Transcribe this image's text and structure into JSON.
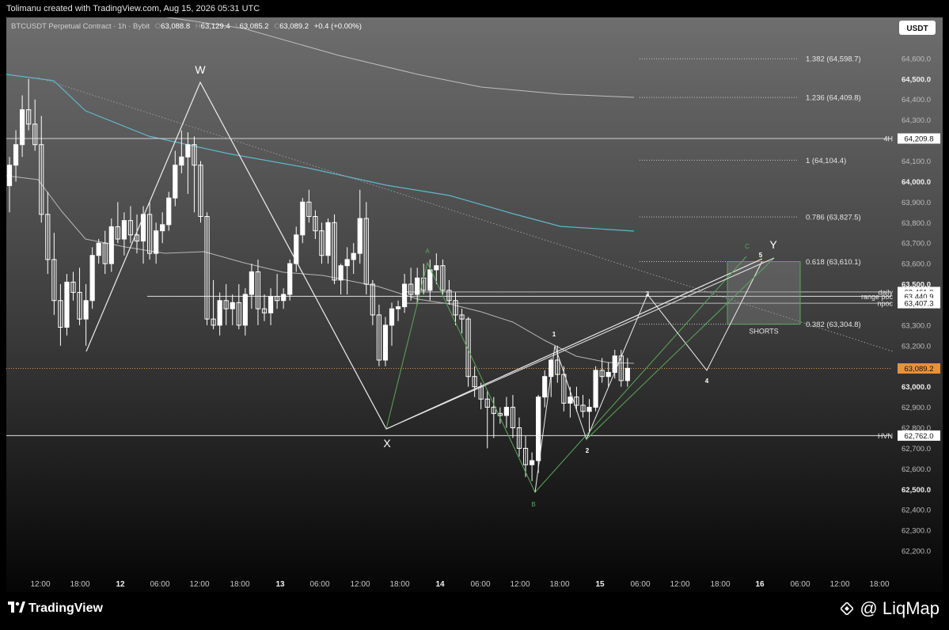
{
  "header": {
    "credit": "Tolimanu created with TradingView.com, Aug 15, 2026 05:31 UTC"
  },
  "legend": {
    "symbol": "BTCUSDT Perpetual Contract · 1h · Bybit",
    "o_label": "O",
    "o": "63,088.8",
    "h_label": "H",
    "h": "63,129.4",
    "l_label": "L",
    "l": "63,085.2",
    "c_label": "C",
    "c": "63,089.2",
    "change": "+0.4 (+0.00%)"
  },
  "currency_button": "USDT",
  "branding": {
    "tradingview": "TradingView",
    "liqmap": "@ LiqMap"
  },
  "colors": {
    "background_top": "#6e6e6e",
    "background_bottom": "#000000",
    "candle": "#ffffff",
    "ema_slow": "#bdbdbd",
    "ema_mid": "#5fb7c8",
    "green_wave": "#5aa85a",
    "price_badge": "#e8923a"
  },
  "chart_data": {
    "type": "candlestick",
    "symbol": "BTCUSDT",
    "timeframe": "1h",
    "ylim": [
      62100,
      64800
    ],
    "x_tick_labels": [
      "12:00",
      "18:00",
      "12",
      "06:00",
      "12:00",
      "18:00",
      "13",
      "06:00",
      "12:00",
      "18:00",
      "14",
      "06:00",
      "12:00",
      "18:00",
      "15",
      "06:00",
      "12:00",
      "18:00",
      "16",
      "06:00",
      "12:00",
      "18:00"
    ],
    "x_tick_bold": [
      false,
      false,
      true,
      false,
      false,
      false,
      true,
      false,
      false,
      false,
      true,
      false,
      false,
      false,
      true,
      false,
      false,
      false,
      true,
      false,
      false,
      false
    ],
    "y_ticks": [
      "62,200.0",
      "62,300.0",
      "62,400.0",
      "62,500.0",
      "62,600.0",
      "62,700.0",
      "62,800.0",
      "62,900.0",
      "63,000.0",
      "63,100.0",
      "63,200.0",
      "63,300.0",
      "63,400.0",
      "63,500.0",
      "63,600.0",
      "63,700.0",
      "63,800.0",
      "63,900.0",
      "64,000.0",
      "64,100.0",
      "64,200.0",
      "64,300.0",
      "64,400.0",
      "64,500.0",
      "64,600.0"
    ],
    "last_price": "63,089.2",
    "price_badges": [
      {
        "label": "4H",
        "value": "64,209.8"
      },
      {
        "label": "daily",
        "value": "63,461.9"
      },
      {
        "label": "range poc",
        "value": "63,440.9"
      },
      {
        "label": "npoc",
        "value": "63,407.3"
      },
      {
        "label": "HVN",
        "value": "62,762.0"
      }
    ],
    "fib_levels": [
      {
        "label": "1.382 (64,598.7)",
        "price": 64598.7
      },
      {
        "label": "1.236 (64,409.8)",
        "price": 64409.8
      },
      {
        "label": "1 (64,104.4)",
        "price": 64104.4
      },
      {
        "label": "0.786 (63,827.5)",
        "price": 63827.5
      },
      {
        "label": "0.618 (63,610.1)",
        "price": 63610.1
      },
      {
        "label": "0.382 (63,304.8)",
        "price": 63304.8
      }
    ],
    "zone_label": "SHORTS",
    "wave_labels_white": [
      "W",
      "X",
      "Y"
    ],
    "wave_labels_green": [
      "A",
      "B",
      "C"
    ],
    "impulse_labels": [
      "1",
      "2",
      "3",
      "4",
      "5"
    ],
    "candles": [
      [
        63980,
        64120,
        63850,
        64080
      ],
      [
        64080,
        64250,
        64000,
        64180
      ],
      [
        64180,
        64420,
        64120,
        64350
      ],
      [
        64350,
        64500,
        64250,
        64280
      ],
      [
        64280,
        64400,
        64150,
        64180
      ],
      [
        64180,
        64320,
        63800,
        63840
      ],
      [
        63840,
        63950,
        63550,
        63620
      ],
      [
        63620,
        63750,
        63350,
        63420
      ],
      [
        63420,
        63500,
        63200,
        63290
      ],
      [
        63290,
        63550,
        63250,
        63510
      ],
      [
        63510,
        63560,
        63420,
        63460
      ],
      [
        63460,
        63580,
        63300,
        63330
      ],
      [
        63330,
        63500,
        63200,
        63420
      ],
      [
        63420,
        63680,
        63380,
        63640
      ],
      [
        63640,
        63720,
        63600,
        63700
      ],
      [
        63700,
        63760,
        63550,
        63600
      ],
      [
        63600,
        63820,
        63560,
        63780
      ],
      [
        63780,
        63900,
        63700,
        63720
      ],
      [
        63720,
        63850,
        63640,
        63810
      ],
      [
        63810,
        63880,
        63700,
        63740
      ],
      [
        63740,
        63840,
        63650,
        63710
      ],
      [
        63710,
        63880,
        63600,
        63840
      ],
      [
        63840,
        63900,
        63620,
        63650
      ],
      [
        63650,
        63800,
        63600,
        63760
      ],
      [
        63760,
        63850,
        63700,
        63790
      ],
      [
        63790,
        63950,
        63760,
        63920
      ],
      [
        63920,
        64150,
        63880,
        64080
      ],
      [
        64080,
        64250,
        64040,
        64120
      ],
      [
        64120,
        64240,
        63940,
        64180
      ],
      [
        64180,
        64220,
        63850,
        64080
      ],
      [
        64080,
        64100,
        63800,
        63830
      ],
      [
        63830,
        63850,
        63300,
        63330
      ],
      [
        63330,
        63520,
        63280,
        63300
      ],
      [
        63300,
        63460,
        63250,
        63420
      ],
      [
        63420,
        63500,
        63300,
        63380
      ],
      [
        63380,
        63450,
        63300,
        63410
      ],
      [
        63410,
        63500,
        63280,
        63300
      ],
      [
        63300,
        63480,
        63250,
        63450
      ],
      [
        63450,
        63600,
        63380,
        63560
      ],
      [
        63560,
        63620,
        63300,
        63380
      ],
      [
        63380,
        63450,
        63320,
        63360
      ],
      [
        63360,
        63480,
        63300,
        63440
      ],
      [
        63440,
        63550,
        63380,
        63420
      ],
      [
        63420,
        63480,
        63380,
        63450
      ],
      [
        63450,
        63620,
        63420,
        63600
      ],
      [
        63600,
        63780,
        63560,
        63740
      ],
      [
        63740,
        63920,
        63700,
        63900
      ],
      [
        63900,
        63960,
        63800,
        63830
      ],
      [
        63830,
        63860,
        63720,
        63760
      ],
      [
        63760,
        63800,
        63600,
        63640
      ],
      [
        63640,
        63820,
        63600,
        63800
      ],
      [
        63800,
        63840,
        63500,
        63520
      ],
      [
        63520,
        63600,
        63450,
        63590
      ],
      [
        63590,
        63680,
        63450,
        63620
      ],
      [
        63620,
        63700,
        63550,
        63650
      ],
      [
        63650,
        63960,
        63600,
        63820
      ],
      [
        63820,
        63900,
        63450,
        63500
      ],
      [
        63500,
        63520,
        63300,
        63350
      ],
      [
        63350,
        63400,
        63100,
        63130
      ],
      [
        63130,
        63340,
        63100,
        63300
      ],
      [
        63300,
        63410,
        63200,
        63380
      ],
      [
        63380,
        63420,
        63320,
        63390
      ],
      [
        63390,
        63550,
        63360,
        63500
      ],
      [
        63500,
        63580,
        63420,
        63450
      ],
      [
        63450,
        63580,
        63400,
        63530
      ],
      [
        63530,
        63600,
        63450,
        63470
      ],
      [
        63470,
        63620,
        63420,
        63570
      ],
      [
        63570,
        63650,
        63500,
        63590
      ],
      [
        63590,
        63620,
        63450,
        63470
      ],
      [
        63470,
        63520,
        63400,
        63420
      ],
      [
        63420,
        63460,
        63300,
        63350
      ],
      [
        63350,
        63380,
        63260,
        63330
      ],
      [
        63330,
        63340,
        63000,
        63050
      ],
      [
        63050,
        63100,
        62950,
        63000
      ],
      [
        63000,
        63020,
        62890,
        62940
      ],
      [
        62940,
        62980,
        62700,
        62900
      ],
      [
        62900,
        62950,
        62750,
        62870
      ],
      [
        62870,
        62900,
        62820,
        62860
      ],
      [
        62860,
        62950,
        62800,
        62900
      ],
      [
        62900,
        62960,
        62750,
        62800
      ],
      [
        62800,
        62850,
        62660,
        62700
      ],
      [
        62700,
        62760,
        62560,
        62620
      ],
      [
        62620,
        62680,
        62540,
        62640
      ],
      [
        62640,
        62960,
        62580,
        62950
      ],
      [
        62950,
        63080,
        62900,
        63050
      ],
      [
        63050,
        63140,
        62950,
        63130
      ],
      [
        63130,
        63200,
        63020,
        63060
      ],
      [
        63060,
        63100,
        62880,
        62920
      ],
      [
        62920,
        63000,
        62850,
        62950
      ],
      [
        62950,
        63000,
        62880,
        62910
      ],
      [
        62910,
        62960,
        62850,
        62880
      ],
      [
        62880,
        62940,
        62780,
        62900
      ],
      [
        62900,
        63100,
        62880,
        63080
      ],
      [
        63080,
        63140,
        63020,
        63050
      ],
      [
        63050,
        63120,
        63000,
        63070
      ],
      [
        63070,
        63180,
        63040,
        63150
      ],
      [
        63150,
        63180,
        63000,
        63030
      ],
      [
        63030,
        63140,
        63000,
        63090
      ]
    ]
  }
}
